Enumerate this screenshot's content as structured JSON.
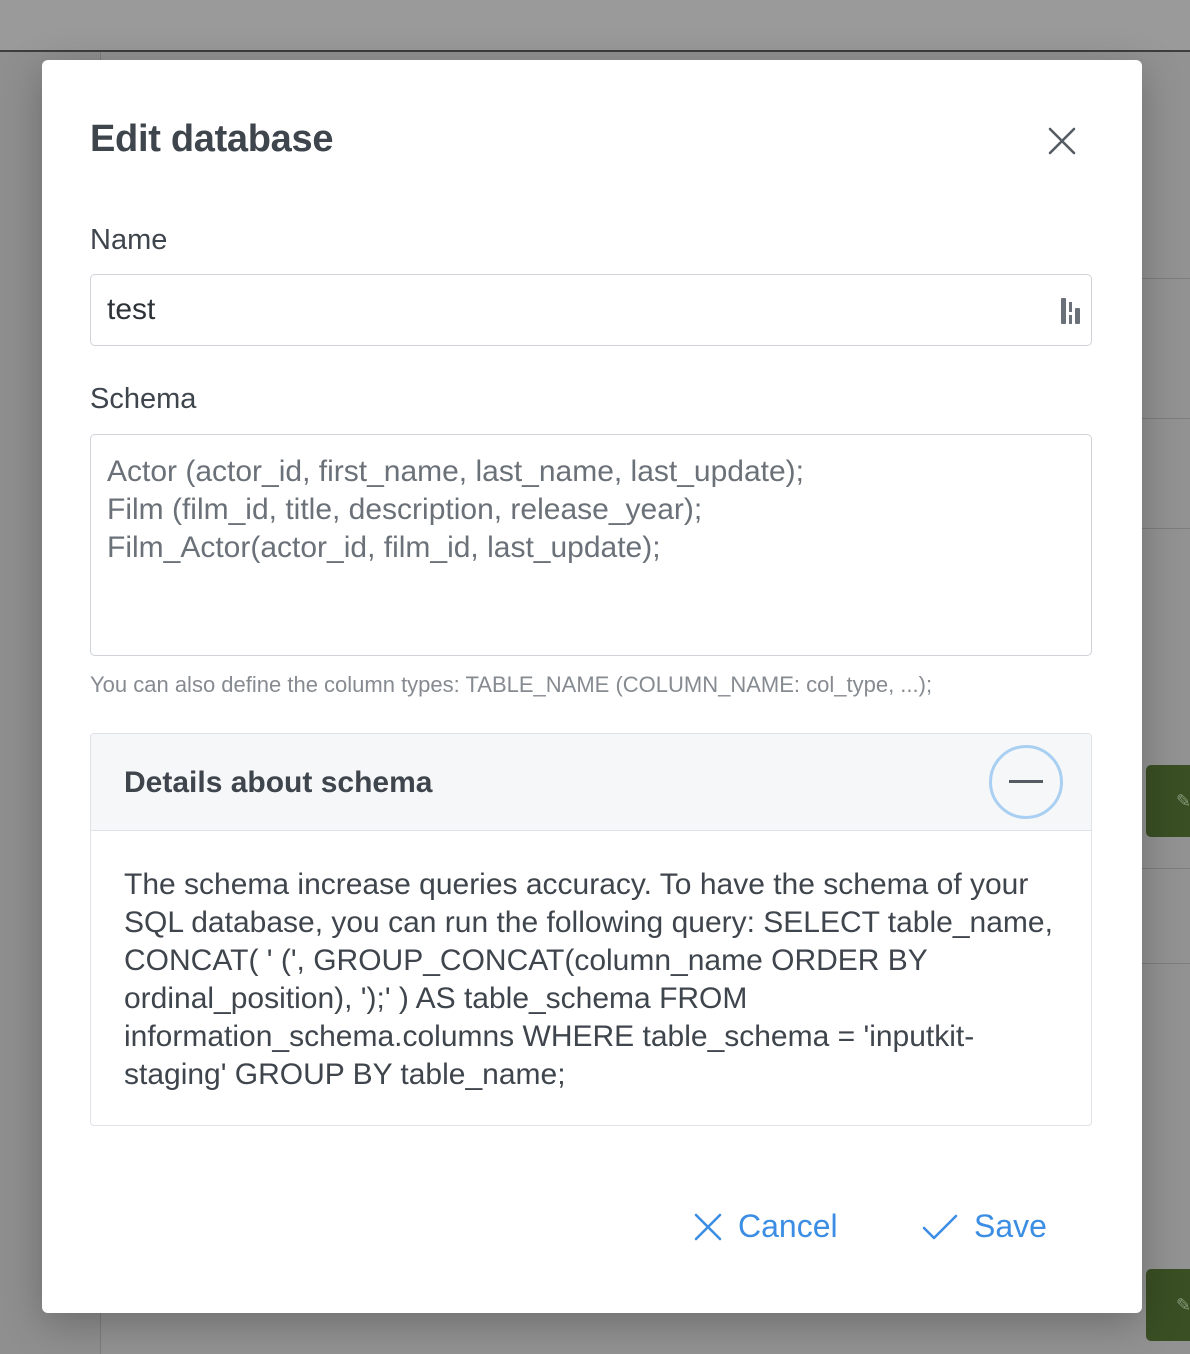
{
  "modal": {
    "title": "Edit database"
  },
  "form": {
    "name_label": "Name",
    "name_value": "test",
    "schema_label": "Schema",
    "schema_value": "Actor (actor_id, first_name, last_name, last_update);\nFilm (film_id, title, description, release_year);\nFilm_Actor(actor_id, film_id, last_update);",
    "schema_hint": "You can also define the column types: TABLE_NAME (COLUMN_NAME: col_type, ...);"
  },
  "details": {
    "title": "Details about schema",
    "body": "The schema increase queries accuracy. To have the schema of your SQL database, you can run the following query: SELECT table_name, CONCAT( ' (', GROUP_CONCAT(column_name ORDER BY ordinal_position), ');' ) AS table_schema FROM information_schema.columns WHERE table_schema = 'inputkit-staging' GROUP BY table_name;",
    "expanded": true
  },
  "actions": {
    "cancel_label": "Cancel",
    "save_label": "Save"
  },
  "icons": {
    "close": "close-icon",
    "password_manager": "password-manager-icon",
    "collapse": "minus-icon",
    "cancel": "x-icon",
    "save": "check-icon"
  },
  "colors": {
    "accent": "#3b8ee3",
    "toggle_ring": "#a9cff2",
    "text": "#3f454c",
    "hint": "#868b91"
  }
}
